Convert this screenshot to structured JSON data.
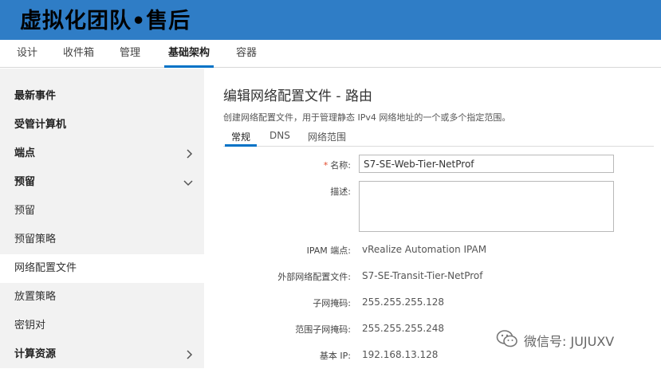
{
  "banner": {
    "title": "虚拟化团队•售后"
  },
  "topnav": {
    "tabs": [
      {
        "label": "设计"
      },
      {
        "label": "收件箱"
      },
      {
        "label": "管理"
      },
      {
        "label": "基础架构"
      },
      {
        "label": "容器"
      }
    ],
    "active_tab": "基础架构",
    "accent": "#0072c6"
  },
  "sidebar": {
    "items": [
      {
        "label": "最新事件"
      },
      {
        "label": "受管计算机"
      },
      {
        "label": "端点",
        "icon": "chevron-right-icon"
      },
      {
        "label": "预留",
        "icon": "chevron-down-icon"
      },
      {
        "label": "预留"
      },
      {
        "label": "预留策略"
      },
      {
        "label": "网络配置文件"
      },
      {
        "label": "放置策略"
      },
      {
        "label": "密钥对"
      },
      {
        "label": "计算资源",
        "icon": "chevron-right-icon"
      }
    ],
    "selected": "网络配置文件"
  },
  "main": {
    "title": "编辑网络配置文件 - 路由",
    "description": "创建网络配置文件，用于管理静态 IPv4 网络地址的一个或多个指定范围。",
    "subtabs": [
      {
        "label": "常规"
      },
      {
        "label": "DNS"
      },
      {
        "label": "网络范围"
      }
    ],
    "active_subtab": "常规",
    "form": {
      "name_required_mark": "*",
      "name_label": "名称:",
      "name_value": "S7-SE-Web-Tier-NetProf",
      "description_label": "描述:",
      "description_value": "",
      "ipam_label": "IPAM 端点:",
      "ipam_value": "vRealize Automation IPAM",
      "external_label": "外部网络配置文件:",
      "external_value": "S7-SE-Transit-Tier-NetProf",
      "subnet_label": "子网掩码:",
      "subnet_value": "255.255.255.128",
      "range_subnet_label": "范围子网掩码:",
      "range_subnet_value": "255.255.255.248",
      "base_ip_label": "基本 IP:",
      "base_ip_value": "192.168.13.128"
    }
  },
  "watermark": {
    "text": "微信号: JUJUXV",
    "icon": "wechat-icon"
  },
  "colors": {
    "banner": "#2f7dc6",
    "sidebar_bg": "#f2f2f2",
    "required": "#e24a2b"
  }
}
